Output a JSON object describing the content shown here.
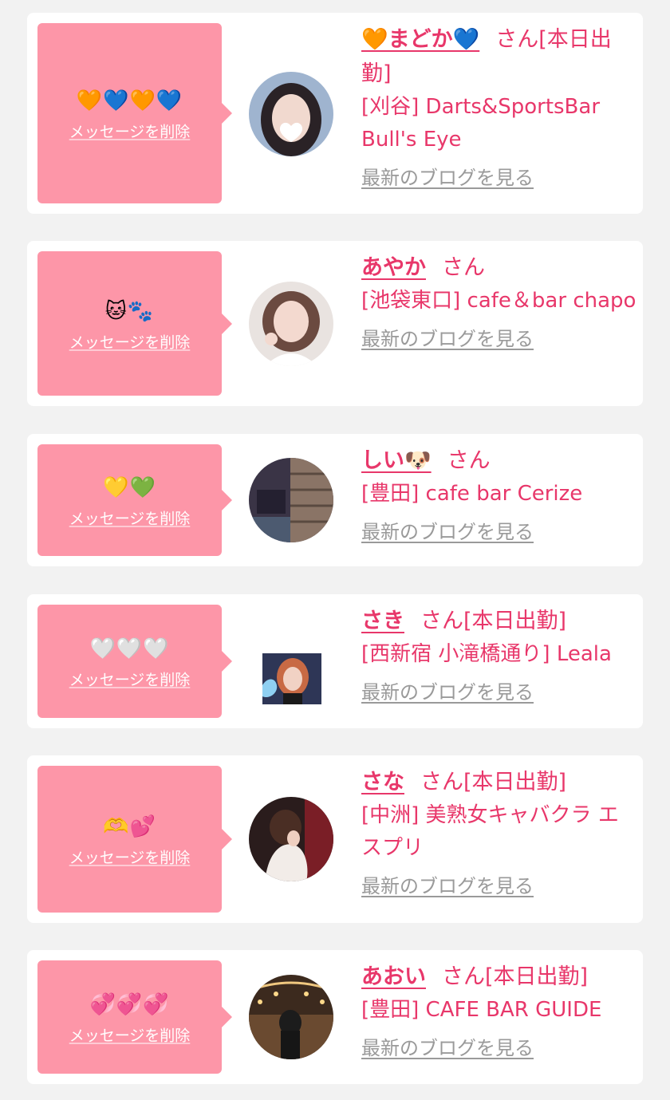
{
  "cards": [
    {
      "message": "🧡💙🧡💙",
      "delete_label": "メッセージを削除",
      "name": "🧡まどか💙",
      "suffix": "さん[本日出勤]",
      "shop": "[刈谷] Darts&SportsBar Bull's Eye",
      "blog_label": "最新のブログを見る"
    },
    {
      "message": "🐱🐾",
      "delete_label": "メッセージを削除",
      "name": "あやか",
      "suffix": "さん",
      "shop": "[池袋東口] cafe＆bar chapo",
      "blog_label": "最新のブログを見る"
    },
    {
      "message": "💛💚",
      "delete_label": "メッセージを削除",
      "name": "しい🐶",
      "suffix": "さん",
      "shop": "[豊田] cafe bar Cerize",
      "blog_label": "最新のブログを見る"
    },
    {
      "message": "🤍🤍🤍",
      "delete_label": "メッセージを削除",
      "name": "さき",
      "suffix": "さん[本日出勤]",
      "shop": "[西新宿 小滝橋通り] Leala",
      "blog_label": "最新のブログを見る"
    },
    {
      "message": "🫶💕",
      "delete_label": "メッセージを削除",
      "name": "さな",
      "suffix": "さん[本日出勤]",
      "shop": "[中洲] 美熟女キャバクラ エスプリ",
      "blog_label": "最新のブログを見る"
    },
    {
      "message": "💞💞💞",
      "delete_label": "メッセージを削除",
      "name": "あおい",
      "suffix": "さん[本日出勤]",
      "shop": "[豊田] CAFE BAR GUIDE",
      "blog_label": "最新のブログを見る"
    }
  ],
  "colors": {
    "page_bg": "#f2f2f2",
    "card_bg": "#ffffff",
    "bubble_bg": "#fd96a8",
    "accent_text": "#e8376a",
    "link_gray": "#9a9a9a"
  },
  "icons": [
    "avatar-photo"
  ]
}
